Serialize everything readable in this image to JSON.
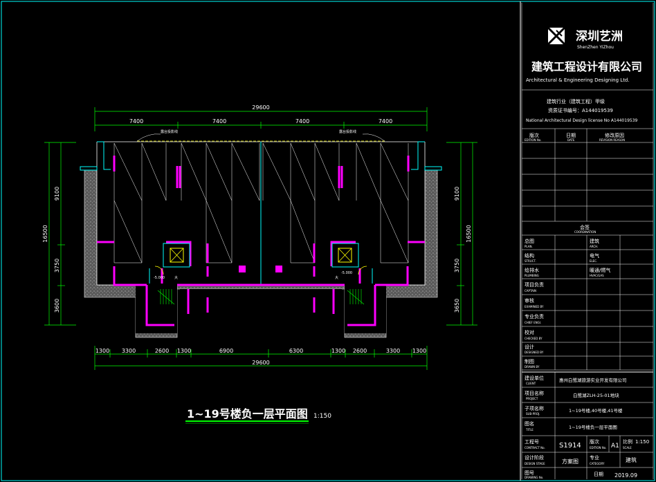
{
  "colors": {
    "background": "#000000",
    "frame": "#00ffff",
    "line": "#ffffff",
    "wall": "#ff00ff",
    "dimension": "#00ff00",
    "fill": "#808080",
    "hatch": "#8a8a8a",
    "accent_yellow": "#ffff00",
    "title_underline": "#00ff00"
  },
  "drawing": {
    "title": "1~19号楼负一层平面图",
    "scale": "1:150",
    "top_total": "29600",
    "top_segments": [
      "7400",
      "7400",
      "7400",
      "7400"
    ],
    "bottom_total": "29600",
    "bottom_segments": [
      "1300",
      "3300",
      "2600",
      "1300",
      "6900",
      "6300",
      "1300",
      "2600",
      "3300",
      "1300"
    ],
    "left_dims": [
      "9100",
      "3750",
      "3600"
    ],
    "left_total": "16500",
    "right_dims": [
      "9100",
      "3750",
      "3650"
    ],
    "right_total": "16500",
    "elevation_labels": [
      "-5.000",
      "-5.000"
    ],
    "stair_labels": [
      "大",
      "大"
    ],
    "balcony_labels": [
      "露台投影线",
      "露台投影线"
    ]
  },
  "titleblock": {
    "company_cn": "深圳艺洲",
    "company_en": "ShenZhen YiZhou",
    "firm_cn": "建筑工程设计有限公司",
    "firm_en": "Architectural & Engineering Designing Ltd.",
    "license_line1": "建筑行业（建筑工程）甲级",
    "license_line2": "资质证书编号：A144019539",
    "license_line3": "National Architectural Design license No A144019539",
    "revision_headers": [
      {
        "cn": "版次",
        "en": "EDITION No."
      },
      {
        "cn": "日期",
        "en": "DATE"
      },
      {
        "cn": "修改原因",
        "en": "REVISION REASON"
      }
    ],
    "coordination": {
      "cn": "会签",
      "en": "COORDINATION"
    },
    "sign_rows": [
      {
        "cn": "总图",
        "en": "PLAN.",
        "cn2": "建筑",
        "en2": "ARCH."
      },
      {
        "cn": "结构",
        "en": "STRUCT.",
        "cn2": "电气",
        "en2": "ELEC."
      },
      {
        "cn": "给排水",
        "en": "PLUMBING",
        "cn2": "暖通/燃气",
        "en2": "HVAC/GAS"
      }
    ],
    "staff_rows": [
      {
        "cn": "项目负责",
        "en": "CAPTAIN"
      },
      {
        "cn": "审核",
        "en": "EXAMINED BY"
      },
      {
        "cn": "专业负责",
        "en": "CHIEF ENGI."
      },
      {
        "cn": "校对",
        "en": "CHECKED BY"
      },
      {
        "cn": "设计",
        "en": "DESIGNED BY"
      },
      {
        "cn": "制图",
        "en": "DRAWN BY"
      }
    ],
    "client": {
      "cn": "建设单位",
      "en": "CLIENT",
      "value": "惠州白鹭湖旅游实业开发有限公司"
    },
    "project": {
      "cn": "项目名称",
      "en": "PROJECT",
      "value": "白鹭湖ZLH-25-01地块"
    },
    "subproject": {
      "cn": "子项名称",
      "en": "SUB-PROJ.",
      "value": "1~19号楼,40号楼,41号楼"
    },
    "title": {
      "cn": "图名",
      "en": "TITLE",
      "value": "1~19号楼负一层平面图"
    },
    "contract": {
      "cn": "工程号",
      "en": "CONTRACT No.",
      "value": "S1914"
    },
    "edition": {
      "cn": "版次",
      "en": "EDITION No.",
      "value": "A1"
    },
    "scale": {
      "cn": "比例",
      "en": "SCALE",
      "value": "1:150"
    },
    "stage": {
      "cn": "设计阶段",
      "en": "DESIGN STAGE",
      "value": "方案图"
    },
    "category": {
      "cn": "专业",
      "en": "CATEGORY",
      "value": "建筑"
    },
    "drawing_no": {
      "cn": "图号",
      "en": "DRAWING No."
    },
    "date": {
      "cn": "日期",
      "value": "2019.09"
    }
  }
}
